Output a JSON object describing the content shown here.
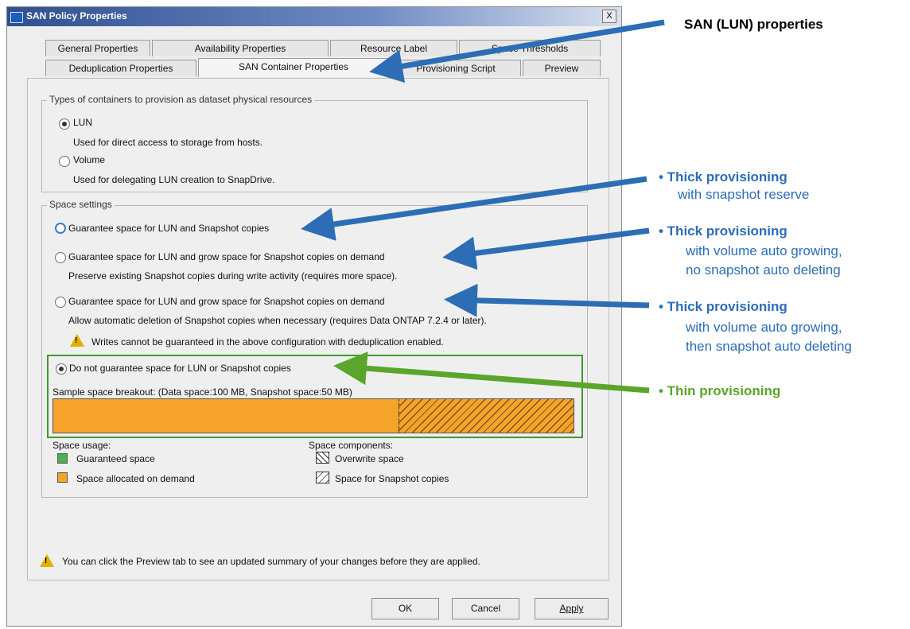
{
  "window": {
    "title": "SAN Policy Properties",
    "close_glyph": "X"
  },
  "tabs_row1": [
    "General Properties",
    "Availability Properties",
    "Resource Label",
    "Space Thresholds"
  ],
  "tabs_row2": [
    "Deduplication Properties",
    "SAN Container Properties",
    "Provisioning Script",
    "Preview"
  ],
  "containers": {
    "legend": "Types of containers to provision as dataset physical resources",
    "lun_label": "LUN",
    "lun_desc": "Used for direct access to storage from hosts.",
    "volume_label": "Volume",
    "volume_desc": "Used for delegating LUN creation to SnapDrive."
  },
  "space": {
    "legend": "Space settings",
    "opt1": "Guarantee space for LUN and Snapshot copies",
    "opt2": "Guarantee space for LUN and grow space for Snapshot copies on demand",
    "opt2_desc": "Preserve existing Snapshot copies during write activity (requires more space).",
    "opt3": "Guarantee space for LUN and grow space for Snapshot copies on demand",
    "opt3_desc": "Allow automatic deletion of Snapshot copies when necessary (requires Data ONTAP 7.2.4 or later).",
    "warning": "Writes cannot be guaranteed in the above configuration with deduplication enabled.",
    "opt4": "Do not guarantee space for LUN or Snapshot copies",
    "breakout": "Sample space breakout: (Data space:100 MB, Snapshot space:50 MB)",
    "data_space_mb": 100,
    "snapshot_space_mb": 50
  },
  "legend": {
    "usage_title": "Space usage:",
    "guaranteed": "Guaranteed space",
    "on_demand": "Space allocated on demand",
    "components_title": "Space components:",
    "overwrite": "Overwrite space",
    "snapshot": "Space for Snapshot copies"
  },
  "footer_note": "You can click the Preview tab to see an updated summary of your changes before they are applied.",
  "buttons": {
    "ok": "OK",
    "cancel": "Cancel",
    "apply": "Apply"
  },
  "annotations": {
    "san": "SAN (LUN) properties",
    "thick1_title": "• Thick provisioning",
    "thick1_sub": "with snapshot reserve",
    "thick2_title": "• Thick provisioning",
    "thick2_sub1": "with volume auto growing,",
    "thick2_sub2": "no snapshot auto deleting",
    "thick3_title": "• Thick provisioning",
    "thick3_sub1": "with volume auto growing,",
    "thick3_sub2": "then snapshot auto deleting",
    "thin": "• Thin provisioning"
  },
  "colors": {
    "blue_annotation": "#2d6db5",
    "green_annotation": "#5aa52b",
    "orange_space": "#f5a32b",
    "green_space": "#4caf50"
  }
}
